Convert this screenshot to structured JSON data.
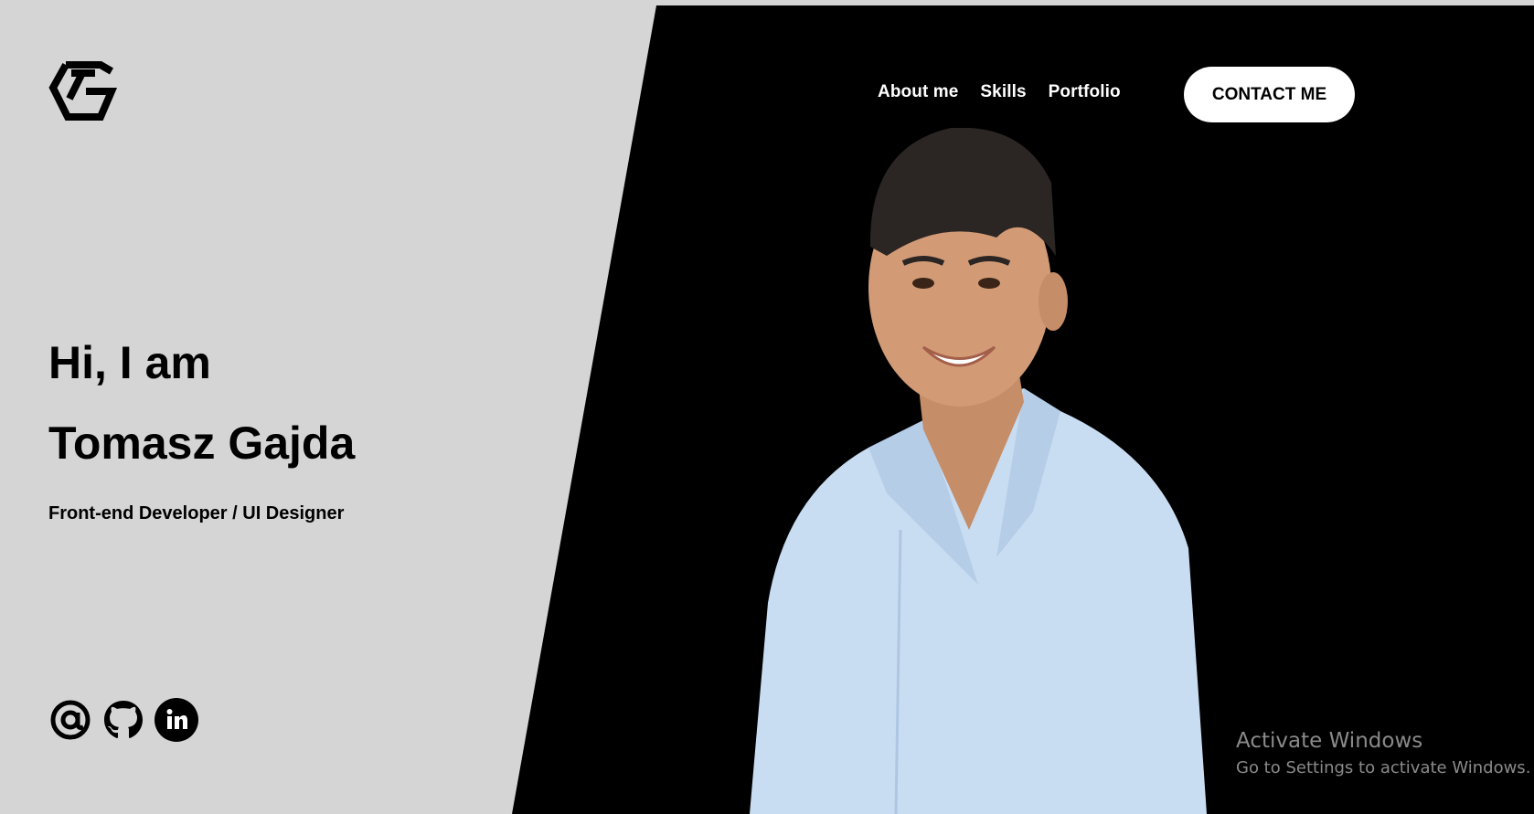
{
  "logo": {
    "icon": "tg-logo-icon"
  },
  "nav": {
    "items": [
      {
        "label": "About me"
      },
      {
        "label": "Skills"
      },
      {
        "label": "Portfolio"
      }
    ],
    "contact_label": "CONTACT ME"
  },
  "hero": {
    "greeting": "Hi, I am",
    "name": "Tomasz Gajda",
    "role": "Front-end Developer / UI Designer"
  },
  "socials": [
    {
      "icon": "email-at-icon"
    },
    {
      "icon": "github-icon"
    },
    {
      "icon": "linkedin-icon"
    }
  ],
  "watermark": {
    "title": "Activate Windows",
    "subtitle": "Go to Settings to activate Windows."
  },
  "colors": {
    "background_light": "#d5d5d5",
    "background_dark": "#000000",
    "button_bg": "#ffffff"
  }
}
